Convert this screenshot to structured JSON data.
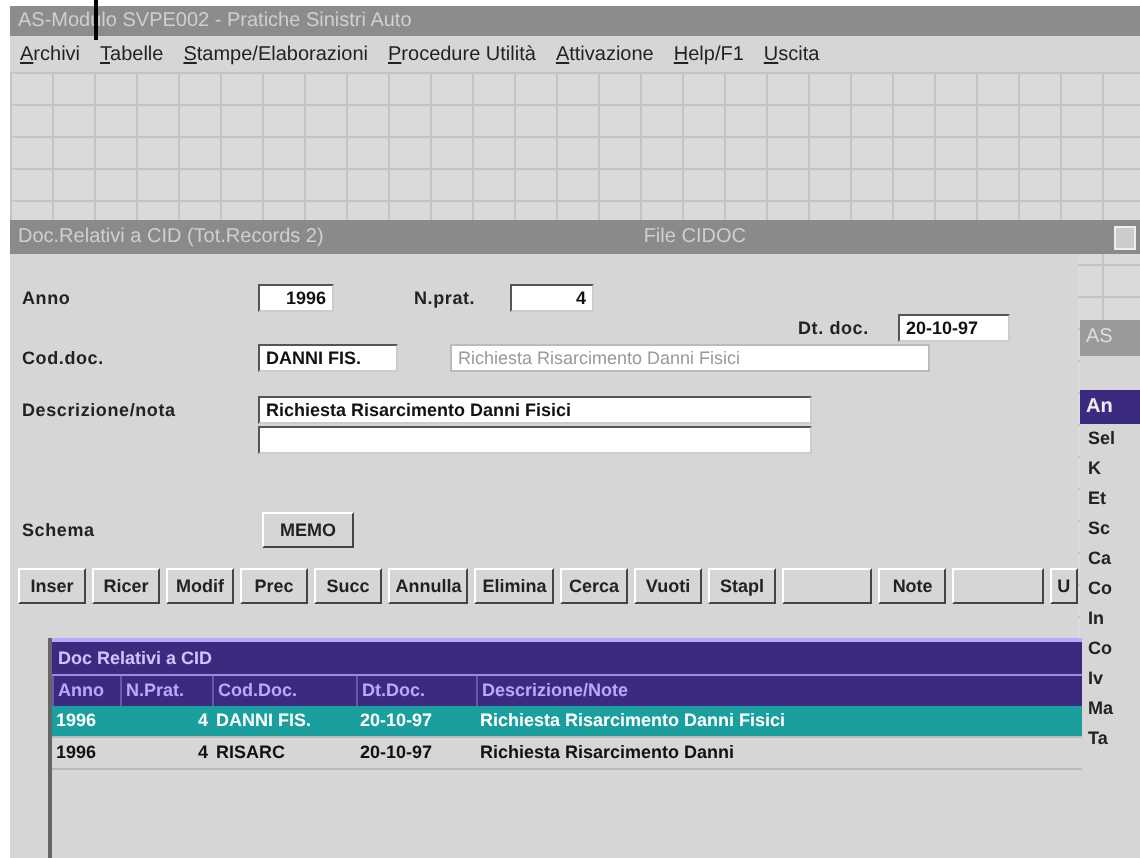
{
  "app_window": {
    "title": "AS-Modulo SVPE002 - Pratiche Sinistri Auto",
    "menu": [
      "Archivi",
      "Tabelle",
      "Stampe/Elaborazioni",
      "Procedure Utilità",
      "Attivazione",
      "Help/F1",
      "Uscita"
    ]
  },
  "dialog": {
    "title": "Doc.Relativi a CID (Tot.Records 2)",
    "file_label": "File CIDOC",
    "anno": {
      "label": "Anno",
      "value": "1996"
    },
    "n_prat": {
      "label": "N.prat.",
      "value": "4"
    },
    "dt_doc": {
      "label": "Dt. doc.",
      "value": "20-10-97"
    },
    "cod_doc": {
      "label": "Cod.doc.",
      "value": "DANNI FIS.",
      "description": "Richiesta Risarcimento Danni Fisici"
    },
    "descrizione": {
      "label": "Descrizione/nota",
      "value": "Richiesta Risarcimento Danni Fisici"
    },
    "schema": {
      "label": "Schema",
      "button": "MEMO"
    },
    "buttons": [
      {
        "kind": "text",
        "label": "Inser"
      },
      {
        "kind": "text",
        "label": "Ricer"
      },
      {
        "kind": "text",
        "label": "Modif"
      },
      {
        "kind": "text",
        "label": "Prec"
      },
      {
        "kind": "text",
        "label": "Succ"
      },
      {
        "kind": "text",
        "label": "Annulla"
      },
      {
        "kind": "text",
        "label": "Elimina"
      },
      {
        "kind": "text",
        "label": "Cerca"
      },
      {
        "kind": "text",
        "label": "Vuoti"
      },
      {
        "kind": "text",
        "label": "Stapl"
      },
      {
        "kind": "blank"
      },
      {
        "kind": "text",
        "label": "Note"
      },
      {
        "kind": "blank"
      },
      {
        "kind": "text",
        "label": "U"
      }
    ],
    "grid": {
      "title": "Doc Relativi a CID",
      "columns": [
        "Anno",
        "N.Prat.",
        "Cod.Doc.",
        "Dt.Doc.",
        "Descrizione/Note"
      ],
      "rows": [
        {
          "cells": [
            "1996",
            "4",
            "DANNI FIS.",
            "20-10-97",
            "Richiesta Risarcimento Danni Fisici"
          ],
          "selected": true
        },
        {
          "cells": [
            "1996",
            "4",
            "RISARC",
            "20-10-97",
            "Richiesta Risarcimento Danni"
          ],
          "selected": false
        }
      ]
    }
  },
  "side_window": {
    "title": "AS",
    "subtitle": "An",
    "labels": [
      "Sel",
      "K",
      "Et",
      "Sc",
      "Ca",
      "Co",
      "In",
      "Co",
      "Iv",
      "Ma",
      "Ta"
    ]
  }
}
